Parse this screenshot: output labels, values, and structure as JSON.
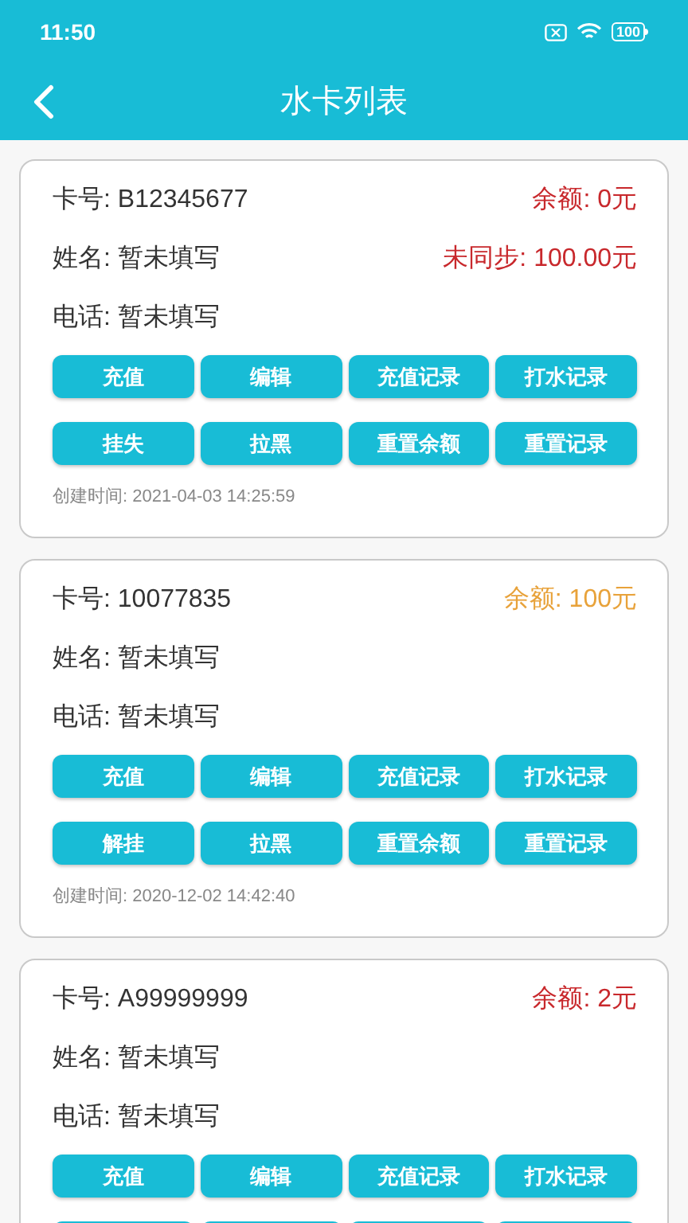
{
  "status_bar": {
    "time": "11:50",
    "battery": "100"
  },
  "header": {
    "title": "水卡列表"
  },
  "cards": [
    {
      "card_no": "卡号: B12345677",
      "balance": {
        "text": "余额: 0元",
        "color": "#c8282c"
      },
      "name": "姓名: 暂未填写",
      "unsynced": {
        "text": "未同步: 100.00元",
        "color": "#c8282c"
      },
      "phone": "电话: 暂未填写",
      "buttons": [
        "充值",
        "编辑",
        "充值记录",
        "打水记录",
        "挂失",
        "拉黑",
        "重置余额",
        "重置记录"
      ],
      "created": "创建时间: 2021-04-03 14:25:59"
    },
    {
      "card_no": "卡号: 10077835",
      "balance": {
        "text": "余额: 100元",
        "color": "#e8a23a"
      },
      "name": "姓名: 暂未填写",
      "phone": "电话: 暂未填写",
      "buttons": [
        "充值",
        "编辑",
        "充值记录",
        "打水记录",
        "解挂",
        "拉黑",
        "重置余额",
        "重置记录"
      ],
      "created": "创建时间: 2020-12-02 14:42:40"
    },
    {
      "card_no": "卡号: A99999999",
      "balance": {
        "text": "余额: 2元",
        "color": "#c8282c"
      },
      "name": "姓名: 暂未填写",
      "phone": "电话: 暂未填写",
      "buttons": [
        "充值",
        "编辑",
        "充值记录",
        "打水记录"
      ],
      "more_buttons_cut": true
    }
  ]
}
